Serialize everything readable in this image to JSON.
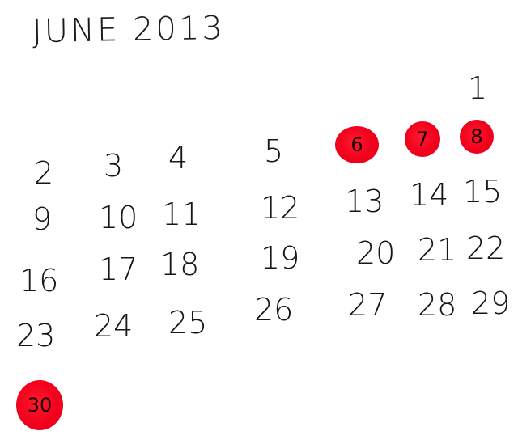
{
  "title": "JUNE 2013",
  "days": {
    "d1": "1",
    "d2": "2",
    "d3": "3",
    "d4": "4",
    "d5": "5",
    "d6": "6",
    "d7": "7",
    "d8": "8",
    "d9": "9",
    "d10": "10",
    "d11": "11",
    "d12": "12",
    "d13": "13",
    "d14": "14",
    "d15": "15",
    "d16": "16",
    "d17": "17",
    "d18": "18",
    "d19": "19",
    "d20": "20",
    "d21": "21",
    "d22": "22",
    "d23": "23",
    "d24": "24",
    "d25": "25",
    "d26": "26",
    "d27": "27",
    "d28": "28",
    "d29": "29",
    "d30": "30"
  },
  "highlighted_days": [
    "6",
    "7",
    "8",
    "30"
  ],
  "colors": {
    "highlight": "#f2001c",
    "ink": "#161616",
    "paper": "#ffffff"
  }
}
